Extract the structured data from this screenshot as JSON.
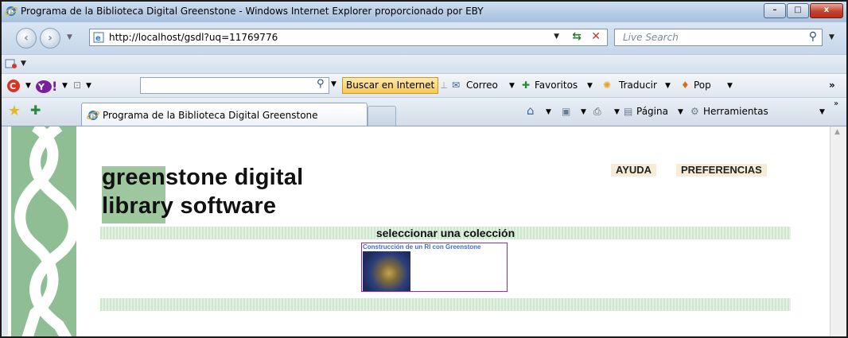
{
  "window": {
    "title": "Programa de la Biblioteca Digital Greenstone - Windows Internet Explorer proporcionado por EBY",
    "buttons": {
      "minimize": "–",
      "maximize": "□",
      "close": "x"
    }
  },
  "address_bar": {
    "url": "http://localhost/gsdl?uq=11769776",
    "search_placeholder": "Live Search"
  },
  "toolbar": {
    "buscar_label": "Buscar en Internet",
    "correo_label": "Correo",
    "favoritos_label": "Favoritos",
    "traducir_label": "Traducir",
    "pop_label": "Pop",
    "more": "»"
  },
  "tabs": {
    "active_label": "Programa de la Biblioteca Digital Greenstone"
  },
  "command_bar": {
    "pagina_label": "Página",
    "herramientas_label": "Herramientas",
    "more": "»"
  },
  "page": {
    "logo_line1": "greenstone digital",
    "logo_line2": "library software",
    "nav_help": "AYUDA",
    "nav_prefs": "PREFERENCIAS",
    "section_title": "seleccionar una colección",
    "collection_title": "Construcción de un RI con Greenstone"
  }
}
